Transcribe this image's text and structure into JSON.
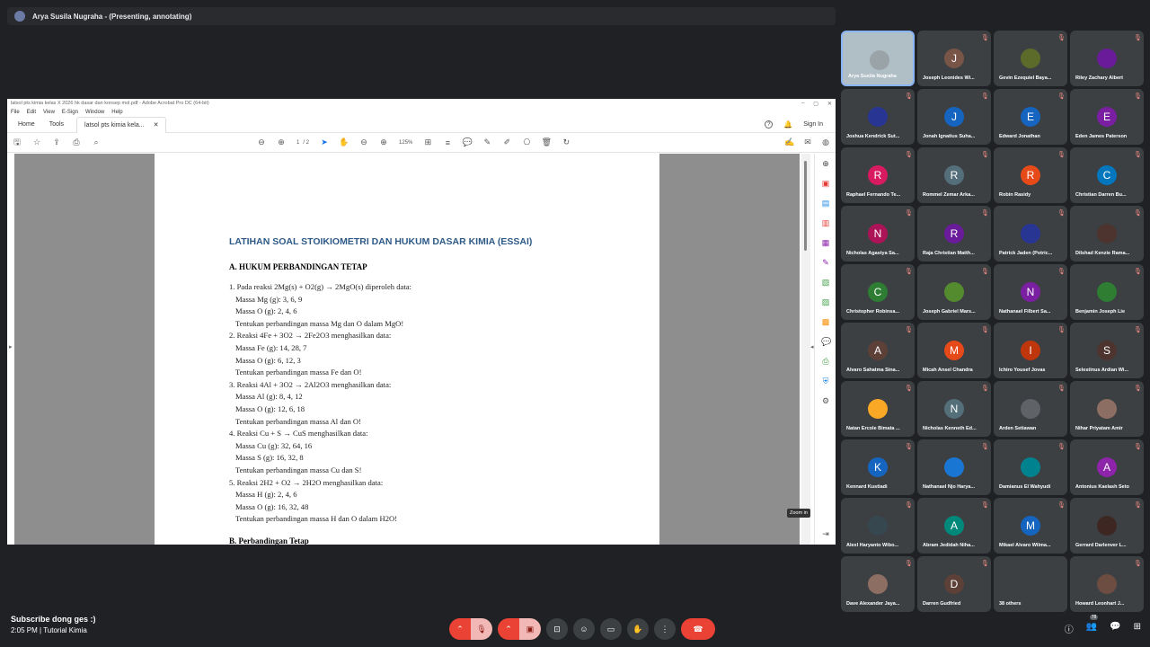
{
  "presenter_bar": {
    "text": "Arya Susila Nugraha - (Presenting, annotating)"
  },
  "acrobat": {
    "window_title": "latsol pts kimia kelas X 2026 hk dasar dan konsep mol.pdf - Adobe Acrobat Pro DC (64-bit)",
    "menu": [
      "File",
      "Edit",
      "View",
      "E-Sign",
      "Window",
      "Help"
    ],
    "tabs": {
      "home": "Home",
      "tools": "Tools",
      "doc": "latsol pts kimia kela..."
    },
    "sign_in": "Sign In",
    "page_current": "1",
    "page_total": "/ 2",
    "zoom": "125%",
    "tooltip": "Zoom in"
  },
  "document": {
    "title": "LATIHAN SOAL STOIKIOMETRI DAN HUKUM DASAR KIMIA (ESSAI)",
    "section_a": "A. HUKUM PERBANDINGAN TETAP",
    "section_b": "B.  Perbandingan Tetap",
    "lines": [
      {
        "t": "1. Pada reaksi 2Mg(s) + O2(g) → 2MgO(s) diperoleh data:",
        "i": false
      },
      {
        "t": "Massa Mg (g): 3, 6, 9",
        "i": true
      },
      {
        "t": "Massa O (g): 2, 4, 6",
        "i": true
      },
      {
        "t": "Tentukan perbandingan massa Mg dan O dalam MgO!",
        "i": true
      },
      {
        "t": "2. Reaksi 4Fe + 3O2 → 2Fe2O3 menghasilkan data:",
        "i": false
      },
      {
        "t": "Massa Fe (g): 14, 28, 7",
        "i": true
      },
      {
        "t": "Massa O (g): 6, 12, 3",
        "i": true
      },
      {
        "t": "Tentukan perbandingan massa Fe dan O!",
        "i": true
      },
      {
        "t": "3. Reaksi 4Al + 3O2 → 2Al2O3 menghasilkan data:",
        "i": false
      },
      {
        "t": "Massa Al (g): 8, 4, 12",
        "i": true
      },
      {
        "t": "Massa O (g): 12, 6, 18",
        "i": true
      },
      {
        "t": "Tentukan perbandingan massa Al dan O!",
        "i": true
      },
      {
        "t": "4. Reaksi Cu + S → CuS menghasilkan data:",
        "i": false
      },
      {
        "t": "Massa Cu (g): 32, 64, 16",
        "i": true
      },
      {
        "t": "Massa S (g): 16, 32, 8",
        "i": true
      },
      {
        "t": "Tentukan perbandingan massa Cu dan S!",
        "i": true
      },
      {
        "t": "5. Reaksi 2H2 + O2 → 2H2O menghasilkan data:",
        "i": false
      },
      {
        "t": "Massa H (g): 2, 4, 6",
        "i": true
      },
      {
        "t": "Massa O (g): 16, 32, 48",
        "i": true
      },
      {
        "t": "Tentukan perbandingan massa H dan O dalam H2O!",
        "i": true
      }
    ]
  },
  "participants": [
    {
      "name": "Arya Susila Nugraha",
      "initial": "",
      "color": "#9aa3a8",
      "mic": ""
    },
    {
      "name": "Joseph Leonides Wi...",
      "initial": "J",
      "color": "#795548",
      "mic": "off"
    },
    {
      "name": "Gevin Ezequiel Baya...",
      "initial": "",
      "color": "#5d6b2a",
      "mic": "off"
    },
    {
      "name": "Riley Zachary Albert",
      "initial": "",
      "color": "#6a1b9a",
      "mic": "off"
    },
    {
      "name": "Joshua Kendrick Sut...",
      "initial": "",
      "color": "#283593",
      "mic": "off"
    },
    {
      "name": "Jonah Ignatius Suha...",
      "initial": "J",
      "color": "#1565c0",
      "mic": "off"
    },
    {
      "name": "Edward Jonathan",
      "initial": "E",
      "color": "#1565c0",
      "mic": "off"
    },
    {
      "name": "Eden James Paterson",
      "initial": "E",
      "color": "#7b1fa2",
      "mic": "off"
    },
    {
      "name": "Raphael Fernando Te...",
      "initial": "R",
      "color": "#d81b60",
      "mic": "off"
    },
    {
      "name": "Rommel Zemar Arka...",
      "initial": "R",
      "color": "#546e7a",
      "mic": "off"
    },
    {
      "name": "Robin Rasidy",
      "initial": "R",
      "color": "#e64a19",
      "mic": "off"
    },
    {
      "name": "Christian Darren Bu...",
      "initial": "C",
      "color": "#0277bd",
      "mic": "off"
    },
    {
      "name": "Nicholas Agastya Sa...",
      "initial": "N",
      "color": "#ad1457",
      "mic": "off"
    },
    {
      "name": "Raja Christian Matth...",
      "initial": "R",
      "color": "#6a1b9a",
      "mic": "off"
    },
    {
      "name": "Patrick Jaden (Potric...",
      "initial": "",
      "color": "#283593",
      "mic": "off"
    },
    {
      "name": "Dilshad Kenzie Rama...",
      "initial": "",
      "color": "#4e342e",
      "mic": "off"
    },
    {
      "name": "Christopher Robinsa...",
      "initial": "C",
      "color": "#2e7d32",
      "mic": "off"
    },
    {
      "name": "Joseph Gabriel Mars...",
      "initial": "",
      "color": "#558b2f",
      "mic": "off"
    },
    {
      "name": "Nathanael Filbert Sa...",
      "initial": "N",
      "color": "#7b1fa2",
      "mic": "off"
    },
    {
      "name": "Benjamin Joseph Lie",
      "initial": "",
      "color": "#2e7d32",
      "mic": "off"
    },
    {
      "name": "Alvaro Sahatma Sina...",
      "initial": "A",
      "color": "#5d4037",
      "mic": "off"
    },
    {
      "name": "Micah Ansel Chandra",
      "initial": "M",
      "color": "#e64a19",
      "mic": "off"
    },
    {
      "name": "Ichiro Yousef Jovas",
      "initial": "I",
      "color": "#bf360c",
      "mic": "off"
    },
    {
      "name": "Selestinus Ardian Wi...",
      "initial": "S",
      "color": "#4e342e",
      "mic": "off"
    },
    {
      "name": "Natan Ercole Bimata ...",
      "initial": "",
      "color": "#f9a825",
      "mic": "off"
    },
    {
      "name": "Nicholas Kenneth Ed...",
      "initial": "N",
      "color": "#546e7a",
      "mic": "off"
    },
    {
      "name": "Arden Setiawan",
      "initial": "",
      "color": "#5f6368",
      "mic": "off"
    },
    {
      "name": "Nihar Priyatam Amir",
      "initial": "",
      "color": "#8d6e63",
      "mic": "off"
    },
    {
      "name": "Kennard Kustiadi",
      "initial": "K",
      "color": "#1565c0",
      "mic": "off"
    },
    {
      "name": "Nathanael Njo Harya...",
      "initial": "",
      "color": "#1976d2",
      "mic": "off"
    },
    {
      "name": "Damianus El Wahyudi",
      "initial": "",
      "color": "#00838f",
      "mic": "off"
    },
    {
      "name": "Antonius Kaelash Seto",
      "initial": "A",
      "color": "#8e24aa",
      "mic": "off"
    },
    {
      "name": "Alexl Haryanto Wibo...",
      "initial": "",
      "color": "#37474f",
      "mic": "off"
    },
    {
      "name": "Abram Jedidah Niha...",
      "initial": "A",
      "color": "#00897b",
      "mic": "off"
    },
    {
      "name": "Mikael Alvaro Wilma...",
      "initial": "M",
      "color": "#1565c0",
      "mic": "off"
    },
    {
      "name": "Gerrard Darlenver L...",
      "initial": "",
      "color": "#3e2723",
      "mic": "off"
    },
    {
      "name": "Dave Alexander Jaya...",
      "initial": "",
      "color": "#8d6e63",
      "mic": "off"
    },
    {
      "name": "Darren Gudfried",
      "initial": "D",
      "color": "#5d4037",
      "mic": "off"
    },
    {
      "name": "38 others",
      "initial": "",
      "color": "#3c4043",
      "mic": ""
    },
    {
      "name": "Howard Leonhart J...",
      "initial": "",
      "color": "#6d4c41",
      "mic": "off"
    }
  ],
  "footer": {
    "line1": "Subscribe dong ges :)",
    "time": "2:05 PM",
    "sep": "|",
    "meeting": "Tutorial Kimia",
    "people_count": "78"
  }
}
